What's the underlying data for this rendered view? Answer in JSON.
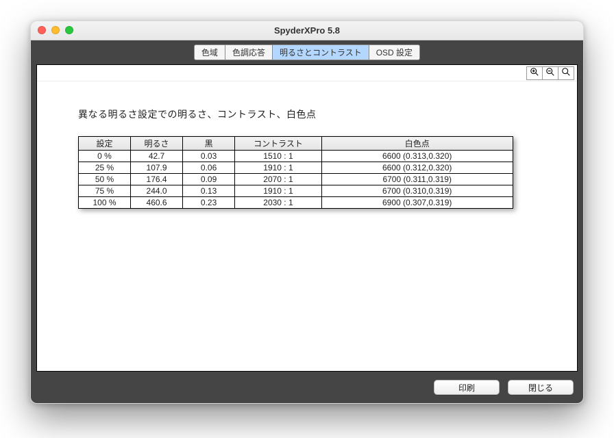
{
  "window": {
    "title": "SpyderXPro 5.8"
  },
  "tabs": {
    "items": [
      "色域",
      "色調応答",
      "明るさとコントラスト",
      "OSD 設定"
    ],
    "activeIndex": 2
  },
  "page": {
    "heading": "異なる明るさ設定での明るさ、コントラスト、白色点"
  },
  "table": {
    "headers": [
      "設定",
      "明るさ",
      "黒",
      "コントラスト",
      "白色点"
    ],
    "rows": [
      [
        "0 %",
        "42.7",
        "0.03",
        "1510 : 1",
        "6600 (0.313,0.320)"
      ],
      [
        "25 %",
        "107.9",
        "0.06",
        "1910 : 1",
        "6600 (0.312,0.320)"
      ],
      [
        "50 %",
        "176.4",
        "0.09",
        "2070 : 1",
        "6700 (0.311,0.319)"
      ],
      [
        "75 %",
        "244.0",
        "0.13",
        "1910 : 1",
        "6700 (0.310,0.319)"
      ],
      [
        "100 %",
        "460.6",
        "0.23",
        "2030 : 1",
        "6900 (0.307,0.319)"
      ]
    ]
  },
  "buttons": {
    "print": "印刷",
    "close": "閉じる"
  },
  "icons": {
    "zoom_in": "zoom-in-icon",
    "zoom_out": "zoom-out-icon",
    "zoom_fit": "zoom-fit-icon"
  }
}
